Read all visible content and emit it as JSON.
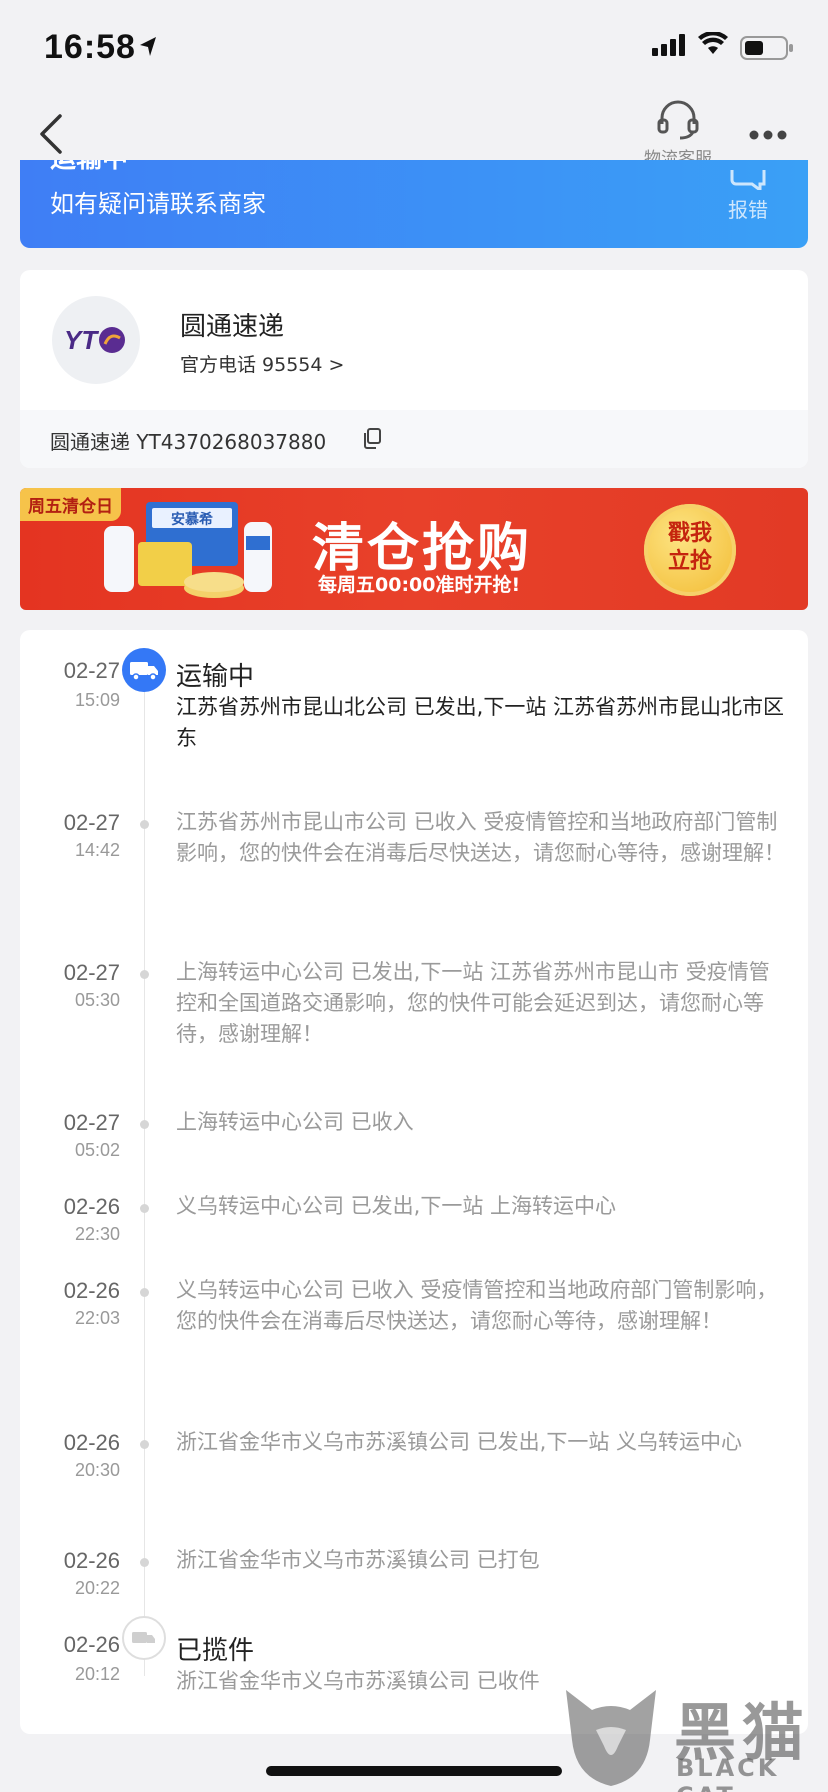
{
  "status_bar": {
    "time": "16:58"
  },
  "nav": {
    "service_label": "物流客服"
  },
  "header_card": {
    "cut_text": "运输中",
    "hint": "如有疑问请联系商家",
    "report_label": "报错"
  },
  "courier": {
    "logo_text": "YT",
    "name": "圆通速递",
    "phone_label": "官方电话 95554 >",
    "tracking_label": "圆通速递 YT4370268037880"
  },
  "banner": {
    "tag": "周五清仓日",
    "brand": "安慕希",
    "title": "清仓抢购",
    "subtitle": "每周五00:00准时开抢!",
    "button": "戳我立抢"
  },
  "timeline": [
    {
      "date": "02-27",
      "time": "15:09",
      "status": "运输中",
      "text": "江苏省苏州市昆山北公司 已发出,下一站 江苏省苏州市昆山北市区东"
    },
    {
      "date": "02-27",
      "time": "14:42",
      "text": "江苏省苏州市昆山市公司 已收入 受疫情管控和当地政府部门管制影响，您的快件会在消毒后尽快送达，请您耐心等待，感谢理解！"
    },
    {
      "date": "02-27",
      "time": "05:30",
      "text": "上海转运中心公司 已发出,下一站 江苏省苏州市昆山市 受疫情管控和全国道路交通影响，您的快件可能会延迟到达，请您耐心等待，感谢理解！"
    },
    {
      "date": "02-27",
      "time": "05:02",
      "text": "上海转运中心公司 已收入"
    },
    {
      "date": "02-26",
      "time": "22:30",
      "text": "义乌转运中心公司 已发出,下一站 上海转运中心"
    },
    {
      "date": "02-26",
      "time": "22:03",
      "text": "义乌转运中心公司 已收入 受疫情管控和当地政府部门管制影响，您的快件会在消毒后尽快送达，请您耐心等待，感谢理解！"
    },
    {
      "date": "02-26",
      "time": "20:30",
      "text": "浙江省金华市义乌市苏溪镇公司 已发出,下一站 义乌转运中心"
    },
    {
      "date": "02-26",
      "time": "20:22",
      "text": "浙江省金华市义乌市苏溪镇公司 已打包"
    },
    {
      "date": "02-26",
      "time": "20:12",
      "status": "已揽件",
      "text": "浙江省金华市义乌市苏溪镇公司 已收件"
    }
  ],
  "watermark": {
    "cn": "黑猫",
    "en": "BLACK CAT"
  },
  "colors": {
    "accent": "#3478f6",
    "banner_red": "#e43421",
    "background": "#f2f2f4"
  }
}
